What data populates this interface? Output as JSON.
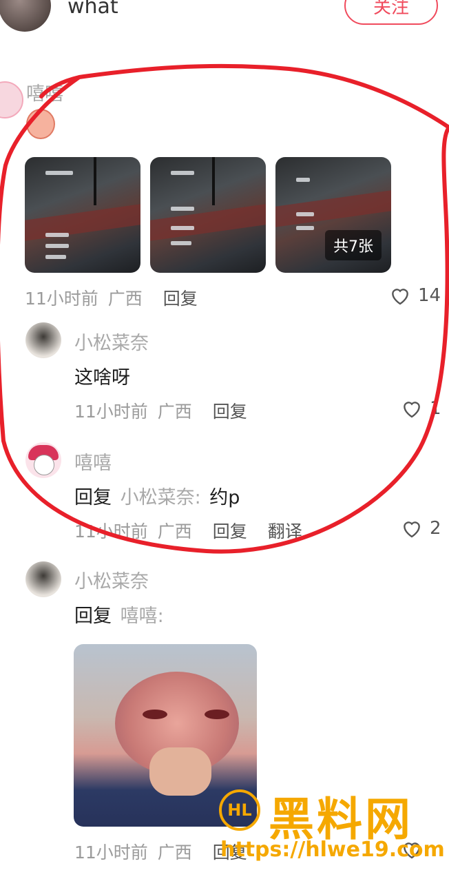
{
  "header": {
    "username": "what",
    "follow_label": "关注"
  },
  "comment": {
    "author": "嘻嘻",
    "image_count_badge": "共7张",
    "time": "11小时前",
    "location": "广西",
    "reply_label": "回复",
    "likes": "14"
  },
  "replies": [
    {
      "author": "小松菜奈",
      "text": "这啥呀",
      "time": "11小时前",
      "location": "广西",
      "reply_label": "回复",
      "likes": "1"
    },
    {
      "author": "嘻嘻",
      "reply_prefix": "回复",
      "reply_to": "小松菜奈:",
      "text": "约p",
      "time": "11小时前",
      "location": "广西",
      "reply_label": "回复",
      "translate_label": "翻译",
      "likes": "2"
    },
    {
      "author": "小松菜奈",
      "reply_prefix": "回复",
      "reply_to": "嘻嘻:",
      "time": "11小时前",
      "location": "广西",
      "reply_label": "回复"
    }
  ],
  "watermark": {
    "brand": "黑料网",
    "url": "https://hlwe19.com",
    "logo_text": "HL"
  },
  "colors": {
    "accent": "#f04a5c",
    "annotation": "#e8202a",
    "watermark": "#f5a800"
  }
}
